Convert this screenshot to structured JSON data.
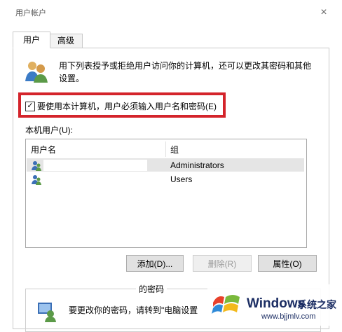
{
  "window": {
    "title": "用户帐户",
    "close_glyph": "×"
  },
  "tabs": [
    {
      "label": "用户"
    },
    {
      "label": "高级"
    }
  ],
  "description": "用下列表授予或拒绝用户访问你的计算机，还可以更改其密码和其他设置。",
  "require_password": {
    "checked": true,
    "mark": "✓",
    "label": "要使用本计算机，用户必须输入用户名和密码(E)"
  },
  "local_users_label": "本机用户(U):",
  "table": {
    "columns": [
      "用户名",
      "组"
    ],
    "rows": [
      {
        "username": "",
        "group": "Administrators",
        "selected": true
      },
      {
        "username": "",
        "group": "Users",
        "selected": false
      }
    ]
  },
  "buttons": {
    "add": "添加(D)...",
    "remove": "删除(R)",
    "properties": "属性(O)"
  },
  "password_section": {
    "title": "的密码",
    "text": "要更改你的密码，请转到\"电脑设置"
  },
  "watermark": {
    "brand": "Windows",
    "site_name": "系统之家",
    "url": "www.bjjmlv.com"
  },
  "colors": {
    "highlight": "#d4242b",
    "selected_row": "#e5e5e5"
  }
}
